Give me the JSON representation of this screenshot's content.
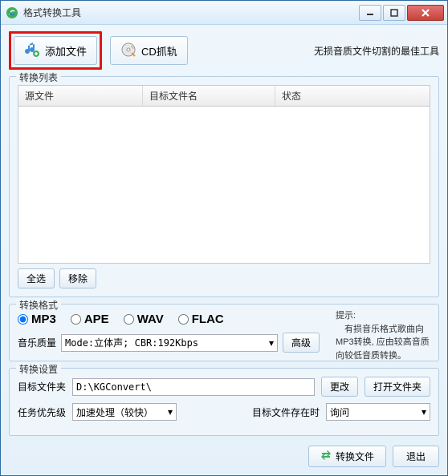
{
  "titlebar": {
    "title": "格式转换工具"
  },
  "toolbar": {
    "add_file_label": "添加文件",
    "cd_rip_label": "CD抓轨",
    "subtitle": "无损音质文件切割的最佳工具"
  },
  "list": {
    "legend": "转换列表",
    "cols": {
      "source": "源文件",
      "target": "目标文件名",
      "status": "状态"
    },
    "select_all": "全选",
    "remove": "移除"
  },
  "format": {
    "legend": "转换格式",
    "options": {
      "mp3": "MP3",
      "ape": "APE",
      "wav": "WAV",
      "flac": "FLAC"
    },
    "selected": "mp3",
    "quality_label": "音乐质量",
    "quality_value": "Mode:立体声; CBR:192Kbps",
    "advanced": "高级",
    "tip_label": "提示:",
    "tip_text": "有损音乐格式歌曲向MP3转换, 应由较高音质向较低音质转换。"
  },
  "settings": {
    "legend": "转换设置",
    "target_folder_label": "目标文件夹",
    "target_folder_value": "D:\\KGConvert\\",
    "change": "更改",
    "open_folder": "打开文件夹",
    "priority_label": "任务优先级",
    "priority_value": "加速处理（较快）",
    "exists_label": "目标文件存在时",
    "exists_value": "询问"
  },
  "footer": {
    "convert": "转换文件",
    "exit": "退出"
  }
}
